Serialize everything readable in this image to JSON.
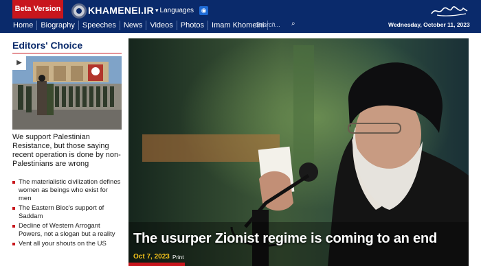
{
  "header": {
    "beta_label": "Beta Version",
    "site_name": "KHAMENEI.IR",
    "languages_label": "Languages",
    "date": "Wednesday, October 11, 2023"
  },
  "nav": {
    "items": [
      "Home",
      "Biography",
      "Speeches",
      "News",
      "Videos",
      "Photos",
      "Imam Khomeini"
    ],
    "search_placeholder": "Search..."
  },
  "editors_choice": {
    "title": "Editors' Choice",
    "lead": "We support Palestinian Resistance, but those saying recent operation is done by non-Palestinians are wrong",
    "links": [
      "The materialistic civilization defines women as beings who exist for men",
      "The Eastern Bloc's support of Saddam",
      "Decline of Western Arrogant Powers, not a slogan but a reality",
      "Vent all your shouts on the US"
    ]
  },
  "hero": {
    "headline": "The usurper Zionist regime is coming to an end",
    "date": "Oct 7, 2023",
    "print_label": "Print"
  },
  "colors": {
    "header_bg": "#0a2a6b",
    "accent_red": "#c8161d",
    "date_yellow": "#f3c21b"
  },
  "icons": [
    "gear-logo-icon",
    "chevron-down-icon",
    "rss-icon",
    "search-icon",
    "play-icon",
    "signature-logo"
  ]
}
